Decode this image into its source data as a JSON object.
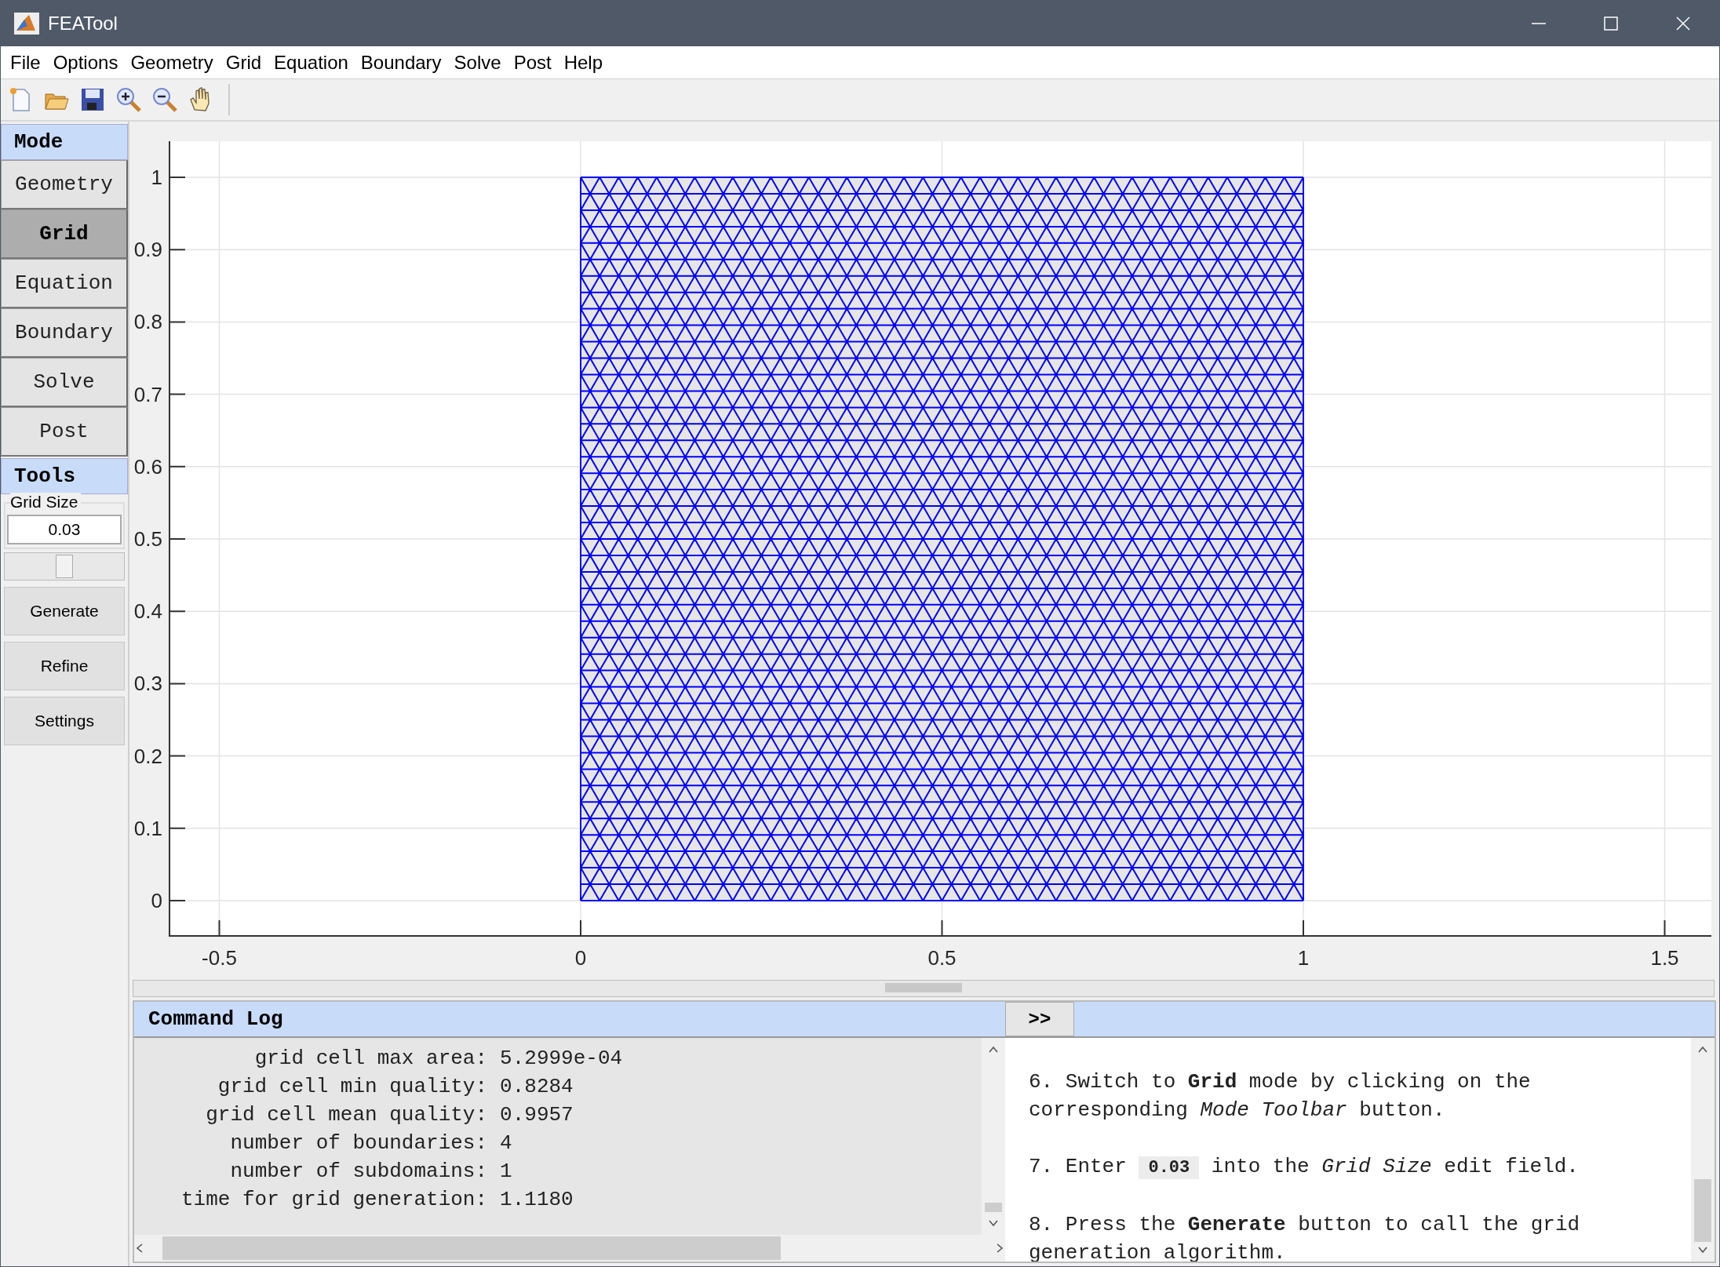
{
  "window": {
    "title": "FEATool"
  },
  "menu": [
    "File",
    "Options",
    "Geometry",
    "Grid",
    "Equation",
    "Boundary",
    "Solve",
    "Post",
    "Help"
  ],
  "sidebar": {
    "mode_header": "Mode",
    "modes": [
      {
        "label": "Geometry",
        "selected": false
      },
      {
        "label": "Grid",
        "selected": true
      },
      {
        "label": "Equation",
        "selected": false
      },
      {
        "label": "Boundary",
        "selected": false
      },
      {
        "label": "Solve",
        "selected": false
      },
      {
        "label": "Post",
        "selected": false
      }
    ],
    "tools_header": "Tools",
    "grid_size": {
      "label": "Grid Size",
      "value": "0.03",
      "level": 0.5
    },
    "buttons": [
      "Generate",
      "Refine",
      "Settings"
    ]
  },
  "plot": {
    "xticks": [
      "-0.5",
      "0",
      "0.5",
      "1",
      "1.5"
    ],
    "yticks": [
      "1",
      "0.9",
      "0.8",
      "0.7",
      "0.6",
      "0.5",
      "0.4",
      "0.3",
      "0.2",
      "0.1",
      "0"
    ]
  },
  "command_log": {
    "title": "Command Log",
    "lines": [
      {
        "label": "grid cell max area:",
        "value": "5.2999e-04"
      },
      {
        "label": "grid cell min quality:",
        "value": "0.8284"
      },
      {
        "label": "grid cell mean quality:",
        "value": "0.9957"
      },
      {
        "label": "number of boundaries:",
        "value": "4"
      },
      {
        "label": "number of subdomains:",
        "value": "1"
      },
      {
        "label": "time for grid generation:",
        "value": "1.1180"
      }
    ]
  },
  "help": {
    "toggle": ">>",
    "paragraphs": [
      [
        {
          "kind": "text",
          "text": "6. Switch to **Grid** mode by clicking on the corresponding *Mode Toolbar* button."
        }
      ],
      [
        {
          "kind": "text",
          "text": "7. Enter "
        },
        {
          "kind": "code",
          "text": "0.03"
        },
        {
          "kind": "text",
          "text": " into the *Grid Size* edit field."
        }
      ],
      [
        {
          "kind": "text",
          "text": "8. Press the **Generate** button to call the grid generation algorithm."
        }
      ]
    ]
  }
}
